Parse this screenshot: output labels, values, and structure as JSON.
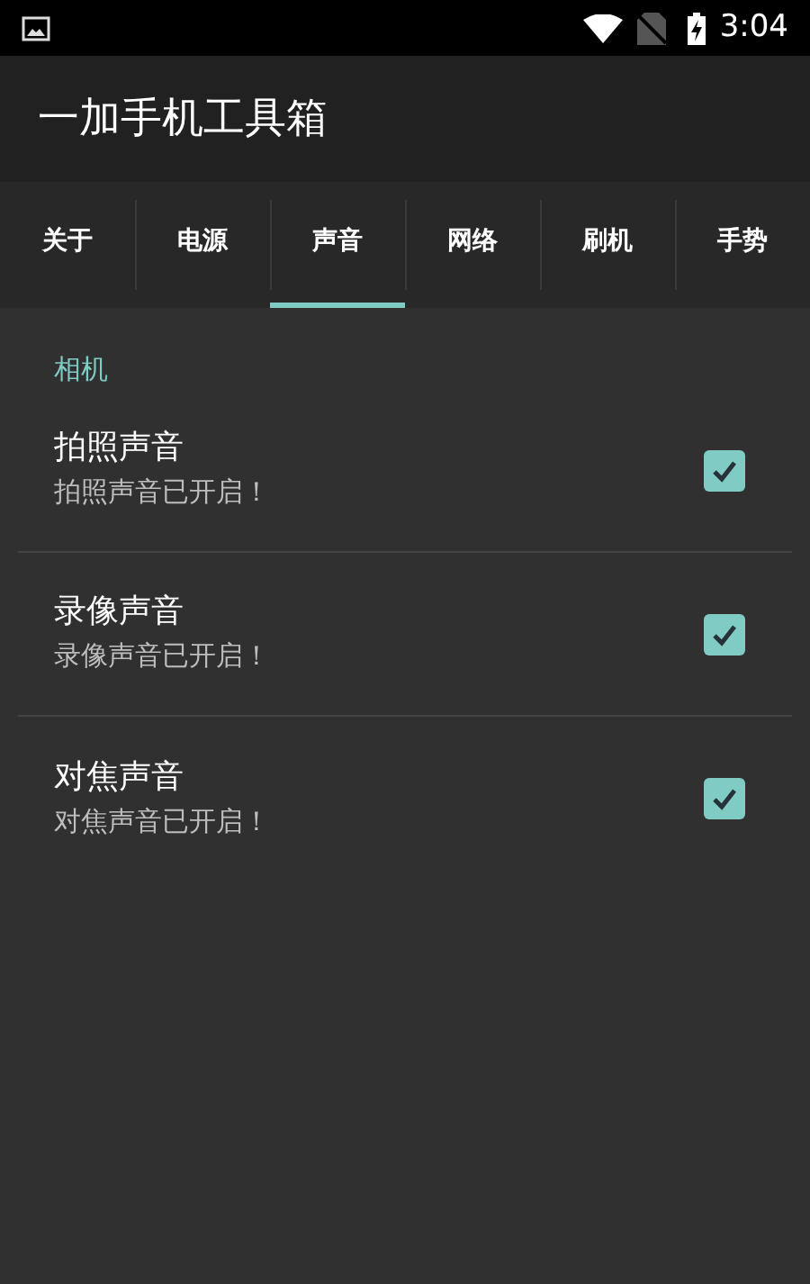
{
  "status_bar": {
    "time": "3:04"
  },
  "app_bar": {
    "title": "一加手机工具箱"
  },
  "tabs": [
    {
      "label": "关于",
      "selected": false
    },
    {
      "label": "电源",
      "selected": false
    },
    {
      "label": "声音",
      "selected": true
    },
    {
      "label": "网络",
      "selected": false
    },
    {
      "label": "刷机",
      "selected": false
    },
    {
      "label": "手势",
      "selected": false
    }
  ],
  "section": {
    "title": "相机"
  },
  "settings": [
    {
      "title": "拍照声音",
      "summary": "拍照声音已开启！",
      "checked": true
    },
    {
      "title": "录像声音",
      "summary": "录像声音已开启！",
      "checked": true
    },
    {
      "title": "对焦声音",
      "summary": "对焦声音已开启！",
      "checked": true
    }
  ]
}
